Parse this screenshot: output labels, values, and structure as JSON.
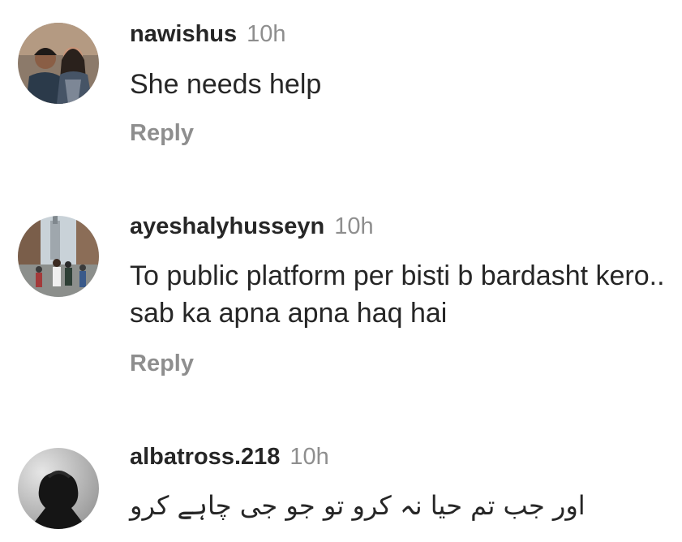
{
  "comments": [
    {
      "username": "nawishus",
      "time": "10h",
      "text": "She needs help",
      "reply_label": "Reply"
    },
    {
      "username": "ayeshalyhusseyn",
      "time": "10h",
      "text": "To public platform per bisti b bardasht kero.. sab ka apna apna haq hai",
      "reply_label": "Reply"
    },
    {
      "username": "albatross.218",
      "time": "10h",
      "text": "اور جب تم حیا نہ کرو تو جو جی چاہے کرو"
    }
  ]
}
